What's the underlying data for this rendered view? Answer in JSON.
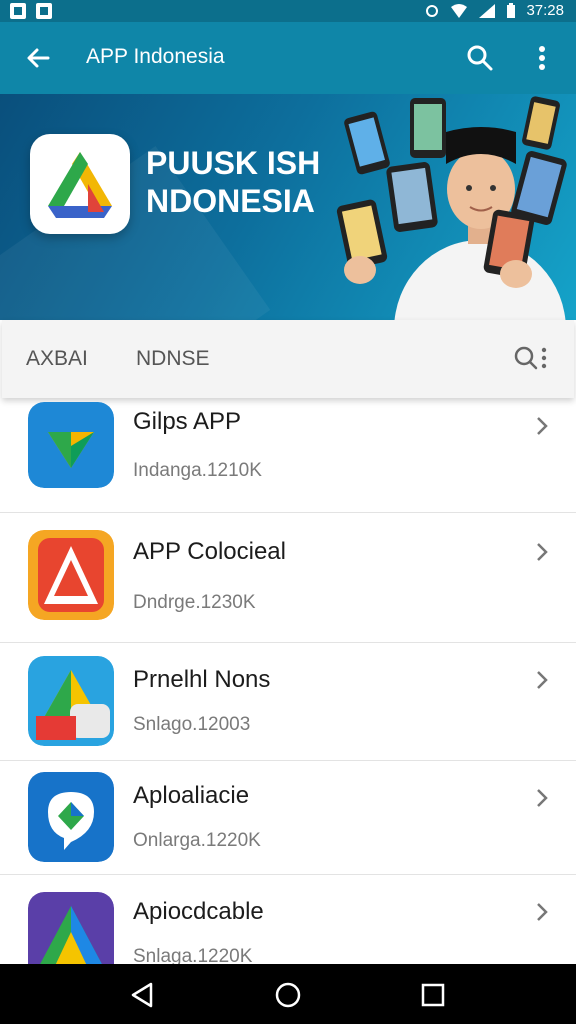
{
  "status_bar": {
    "time": "37:28"
  },
  "app_bar": {
    "title": "APP Indonesia"
  },
  "banner": {
    "headline_line1": "PUUSK ISH",
    "headline_line2": "NDONESIA"
  },
  "filter_bar": {
    "filter_1": "AXBAI",
    "filter_2": "NDNSE"
  },
  "apps": [
    {
      "name": "Gilps APP",
      "subtitle": "Indanga.1210K"
    },
    {
      "name": "APP Colocieal",
      "subtitle": "Dndrge.1230K"
    },
    {
      "name": "Prnelhl Nons",
      "subtitle": "Snlago.12003"
    },
    {
      "name": "Aploaliacie",
      "subtitle": "Onlarga.1220K"
    },
    {
      "name": "Apiocdcable",
      "subtitle": "Snlaga.1220K"
    }
  ],
  "colors": {
    "app_bar": "#0f86a8",
    "status_bar": "#0c6f8c",
    "banner": "#0d6f9d"
  },
  "icons": [
    "back-arrow-icon",
    "search-icon",
    "more-vert-icon",
    "chevron-right-icon",
    "nav-back-icon",
    "nav-home-icon",
    "nav-recents-icon"
  ]
}
